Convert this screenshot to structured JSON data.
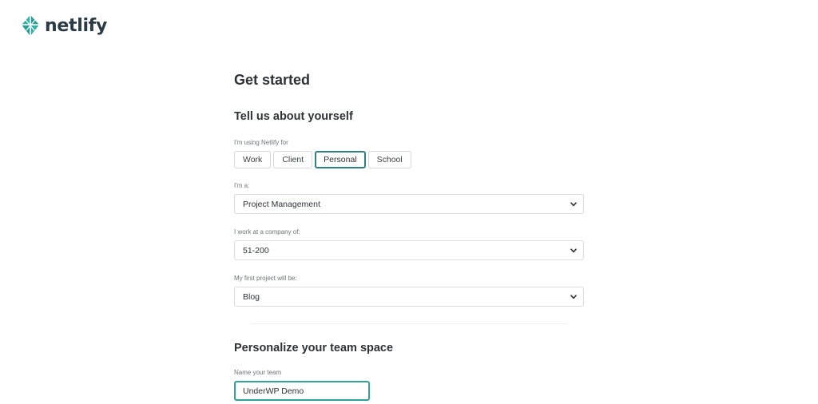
{
  "brand": {
    "name": "netlify",
    "logo_icon": "netlify-diamond-icon",
    "accent_color": "#30a49b"
  },
  "page": {
    "title": "Get started"
  },
  "about": {
    "heading": "Tell us about yourself",
    "using_label": "I'm using Netlify for",
    "options": [
      {
        "label": "Work",
        "selected": false
      },
      {
        "label": "Client",
        "selected": false
      },
      {
        "label": "Personal",
        "selected": true
      },
      {
        "label": "School",
        "selected": false
      }
    ],
    "role_label": "I'm a:",
    "role_value": "Project Management",
    "company_label": "I work at a company of:",
    "company_value": "51-200",
    "project_label": "My first project will be:",
    "project_value": "Blog",
    "dropdown_icon": "chevron-down-icon"
  },
  "team": {
    "heading": "Personalize your team space",
    "name_label": "Name your team",
    "name_value": "UnderWP Demo"
  }
}
